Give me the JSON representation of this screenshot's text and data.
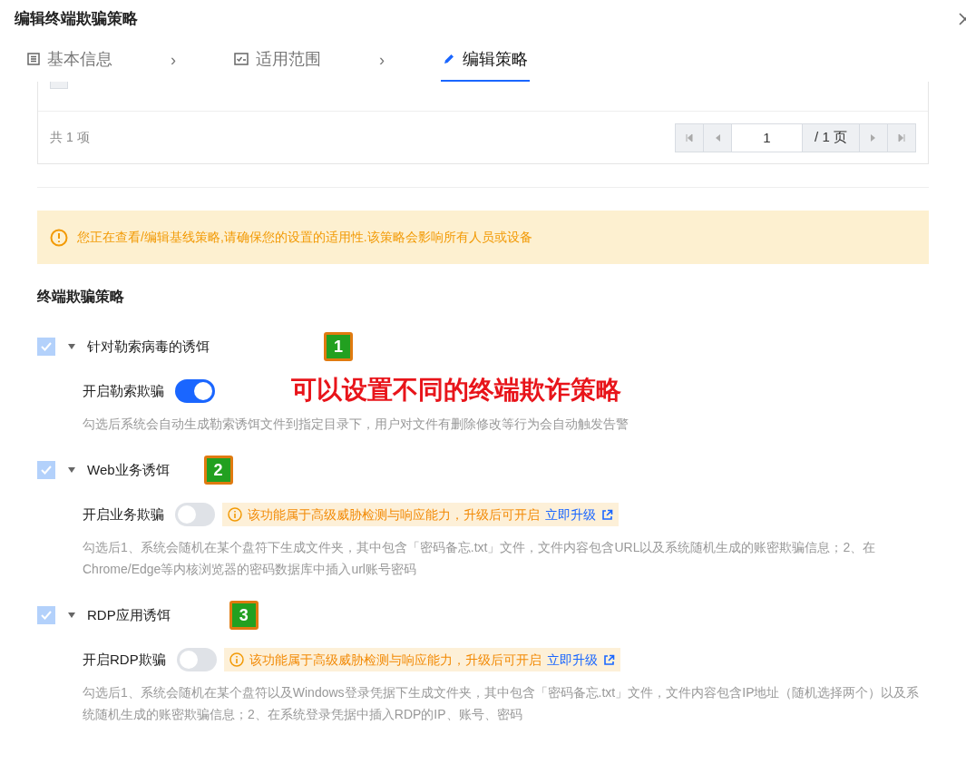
{
  "dialog": {
    "title": "编辑终端欺骗策略"
  },
  "steps": [
    {
      "label": "基本信息",
      "kind": "info",
      "selected": false,
      "separator": "›"
    },
    {
      "label": "适用范围",
      "kind": "scope",
      "selected": false,
      "separator": "›"
    },
    {
      "label": "编辑策略",
      "kind": "edit",
      "selected": true
    }
  ],
  "table": {
    "row": {
      "checked": false
    },
    "total": "共 1 项",
    "pagination": {
      "page": "1",
      "pages": "/ 1 页"
    }
  },
  "alert": {
    "text": "您正在查看/编辑基线策略,请确保您的设置的适用性.该策略会影响所有人员或设备"
  },
  "section": {
    "title": "终端欺骗策略"
  },
  "annotation": {
    "text": "可以设置不同的终端欺诈策略"
  },
  "policies": [
    {
      "title": "针对勒索病毒的诱饵",
      "checked": true,
      "expanded": true,
      "badge": "1",
      "toggle_label": "开启勒索欺骗",
      "on": true,
      "description": "勾选后系统会自动生成勒索诱饵文件到指定目录下，用户对文件有删除修改等行为会自动触发告警"
    },
    {
      "title": "Web业务诱饵",
      "checked": true,
      "expanded": true,
      "badge": "2",
      "toggle_label": "开启业务欺骗",
      "on": false,
      "notice": "该功能属于高级威胁检测与响应能力，升级后可开启",
      "notice_link": "立即升级",
      "description": "勾选后1、系统会随机在某个盘符下生成文件夹，其中包含「密码备忘.txt」文件，文件内容包含URL以及系统随机生成的账密欺骗信息；2、在Chrome/Edge等内核浏览器的密码数据库中插入url账号密码"
    },
    {
      "title": "RDP应用诱饵",
      "checked": true,
      "expanded": true,
      "badge": "3",
      "toggle_label": "开启RDP欺骗",
      "on": false,
      "notice": "该功能属于高级威胁检测与响应能力，升级后可开启",
      "notice_link": "立即升级",
      "description": "勾选后1、系统会随机在某个盘符以及Windows登录凭据下生成文件夹，其中包含「密码备忘.txt」文件，文件内容包含IP地址（随机选择两个）以及系统随机生成的账密欺骗信息；2、在系统登录凭据中插入RDP的IP、账号、密码"
    }
  ]
}
